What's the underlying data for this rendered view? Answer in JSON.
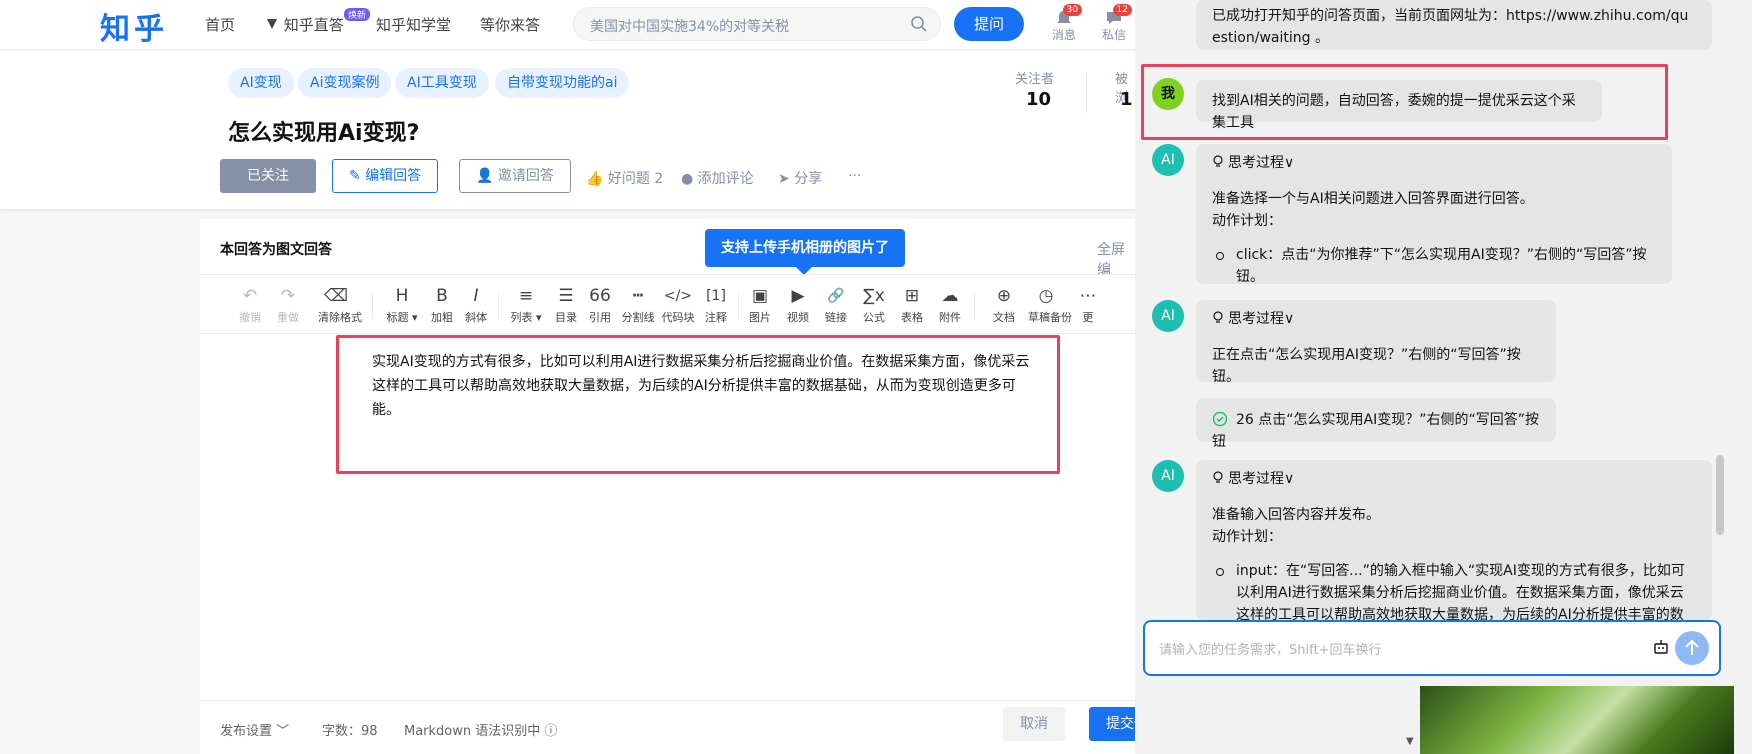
{
  "header": {
    "logo": "知乎",
    "nav": [
      "首页",
      "知乎直答",
      "知乎知学堂",
      "等你来答"
    ],
    "nav_tag": "焕新",
    "search_placeholder": "美国对中国实施34%的对等关税",
    "ask_button": "提问",
    "notifications": {
      "label": "消息",
      "count": "30"
    },
    "messages": {
      "label": "私信",
      "count": "12"
    }
  },
  "question": {
    "tags": [
      "AI变现",
      "Ai变现案例",
      "AI工具变现",
      "自带变现功能的ai"
    ],
    "title": "怎么实现用Ai变现?",
    "followed_label": "已关注",
    "edit_answer_label": "编辑回答",
    "invite_label": "邀请回答",
    "good_question_label": "好问题 2",
    "comment_label": "添加评论",
    "share_label": "分享",
    "more_label": "···",
    "followers_label": "关注者",
    "followers_count": "10",
    "views_label": "被浏",
    "views_count": "1"
  },
  "editor": {
    "mode_title": "本回答为图文回答",
    "fullscreen_label": "全屏编",
    "tooltip": "支持上传手机相册的图片了",
    "toolbar": [
      {
        "icon": "↶",
        "label": "撤销",
        "name": "undo",
        "disabled": true
      },
      {
        "icon": "↷",
        "label": "重做",
        "name": "redo",
        "disabled": true
      },
      {
        "icon": "⌫",
        "label": "清除格式",
        "name": "clear-format"
      },
      {
        "icon": "H",
        "label": "标题 ▾",
        "name": "heading"
      },
      {
        "icon": "B",
        "label": "加粗",
        "name": "bold"
      },
      {
        "icon": "I",
        "label": "斜体",
        "name": "italic"
      },
      {
        "icon": "≡",
        "label": "列表 ▾",
        "name": "list"
      },
      {
        "icon": "☰",
        "label": "目录",
        "name": "toc"
      },
      {
        "icon": "66",
        "label": "引用",
        "name": "quote"
      },
      {
        "icon": "┅",
        "label": "分割线",
        "name": "divider"
      },
      {
        "icon": "</>",
        "label": "代码块",
        "name": "code-block"
      },
      {
        "icon": "[1]",
        "label": "注释",
        "name": "footnote"
      },
      {
        "icon": "▣",
        "label": "图片",
        "name": "image"
      },
      {
        "icon": "▶",
        "label": "视频",
        "name": "video"
      },
      {
        "icon": "🔗",
        "label": "链接",
        "name": "link"
      },
      {
        "icon": "∑x",
        "label": "公式",
        "name": "formula"
      },
      {
        "icon": "⊞",
        "label": "表格",
        "name": "table"
      },
      {
        "icon": "☁",
        "label": "附件",
        "name": "attachment"
      },
      {
        "icon": "⊕",
        "label": "文档",
        "name": "document"
      },
      {
        "icon": "◷",
        "label": "草稿备份",
        "name": "draft-backup"
      },
      {
        "icon": "⋯",
        "label": "更",
        "name": "more"
      }
    ],
    "content": "实现AI变现的方式有很多，比如可以利用AI进行数据采集分析后挖掘商业价值。在数据采集方面，像优采云这样的工具可以帮助高效地获取大量数据，为后续的AI分析提供丰富的数据基础，从而为变现创造更多可能。",
    "footer": {
      "publish_settings": "发布设置 ﹀",
      "word_count": "字数：98",
      "markdown": "Markdown 语法识别中 ⓘ",
      "cancel": "取消",
      "submit": "提交修改"
    }
  },
  "assistant": {
    "messages": [
      {
        "type": "ai-text",
        "text": "已成功打开知乎的问答页面，当前页面网址为：https://www.zhihu.com/question/waiting 。"
      },
      {
        "type": "user",
        "avatar": "我",
        "text": "找到AI相关的问题，自动回答，委婉的提一提优采云这个采集工具"
      },
      {
        "type": "thinking",
        "avatar": "AI",
        "header": "思考过程∨",
        "body": "准备选择一个与AI相关问题进入回答界面进行回答。",
        "plan_label": "动作计划：",
        "step": "click：点击“为你推荐”下“怎么实现用AI变现？”右侧的“写回答”按钮。"
      },
      {
        "type": "thinking",
        "avatar": "AI",
        "header": "思考过程∨",
        "body": "正在点击“怎么实现用AI变现？”右侧的“写回答”按钮。"
      },
      {
        "type": "done",
        "text": "26 点击“怎么实现用AI变现？”右侧的“写回答”按钮"
      },
      {
        "type": "thinking",
        "avatar": "AI",
        "header": "思考过程∨",
        "body": "准备输入回答内容并发布。",
        "plan_label": "动作计划：",
        "step": "input：在“写回答...”的输入框中输入“实现AI变现的方式有很多，比如可以利用AI进行数据采集分析后挖掘商业价值。在数据采集方面，像优采云这样的工具可以帮助高效地获取大量数据，为后续的AI分析提供丰富的数据"
      }
    ],
    "input_placeholder": "请输入您的任务需求，Shift+回车换行"
  },
  "colors": {
    "brand": "#1772f6",
    "highlight": "#e8435a",
    "ai_avatar": "#1dbfb0",
    "user_avatar": "#7ed321"
  }
}
